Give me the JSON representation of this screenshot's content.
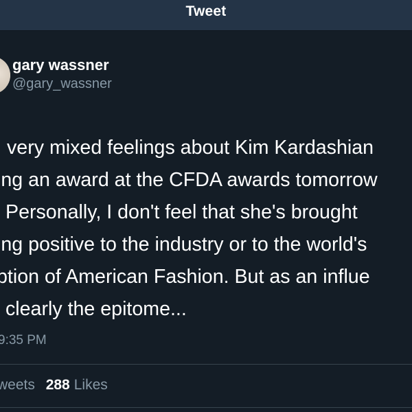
{
  "nav": {
    "title": "Tweet"
  },
  "tweet": {
    "display_name": "gary wassner",
    "handle": "@gary_wassner",
    "lines": [
      "very mixed feelings about Kim Kardashian",
      "ing an award at the CFDA awards tomorrow",
      "Personally, I don't feel that she's brought",
      "ing positive to the industry or to the world's",
      "ption of American Fashion. But as an influe",
      "clearly the epitome..."
    ],
    "timestamp": "9:35 PM"
  },
  "stats": {
    "retweets_label": "weets",
    "likes_count": "288",
    "likes_label": "Likes"
  },
  "colors": {
    "background": "#141d26",
    "nav_background": "#243447",
    "primary_text": "#ffffff",
    "secondary_text": "#8899a6",
    "divider": "#38444d"
  }
}
